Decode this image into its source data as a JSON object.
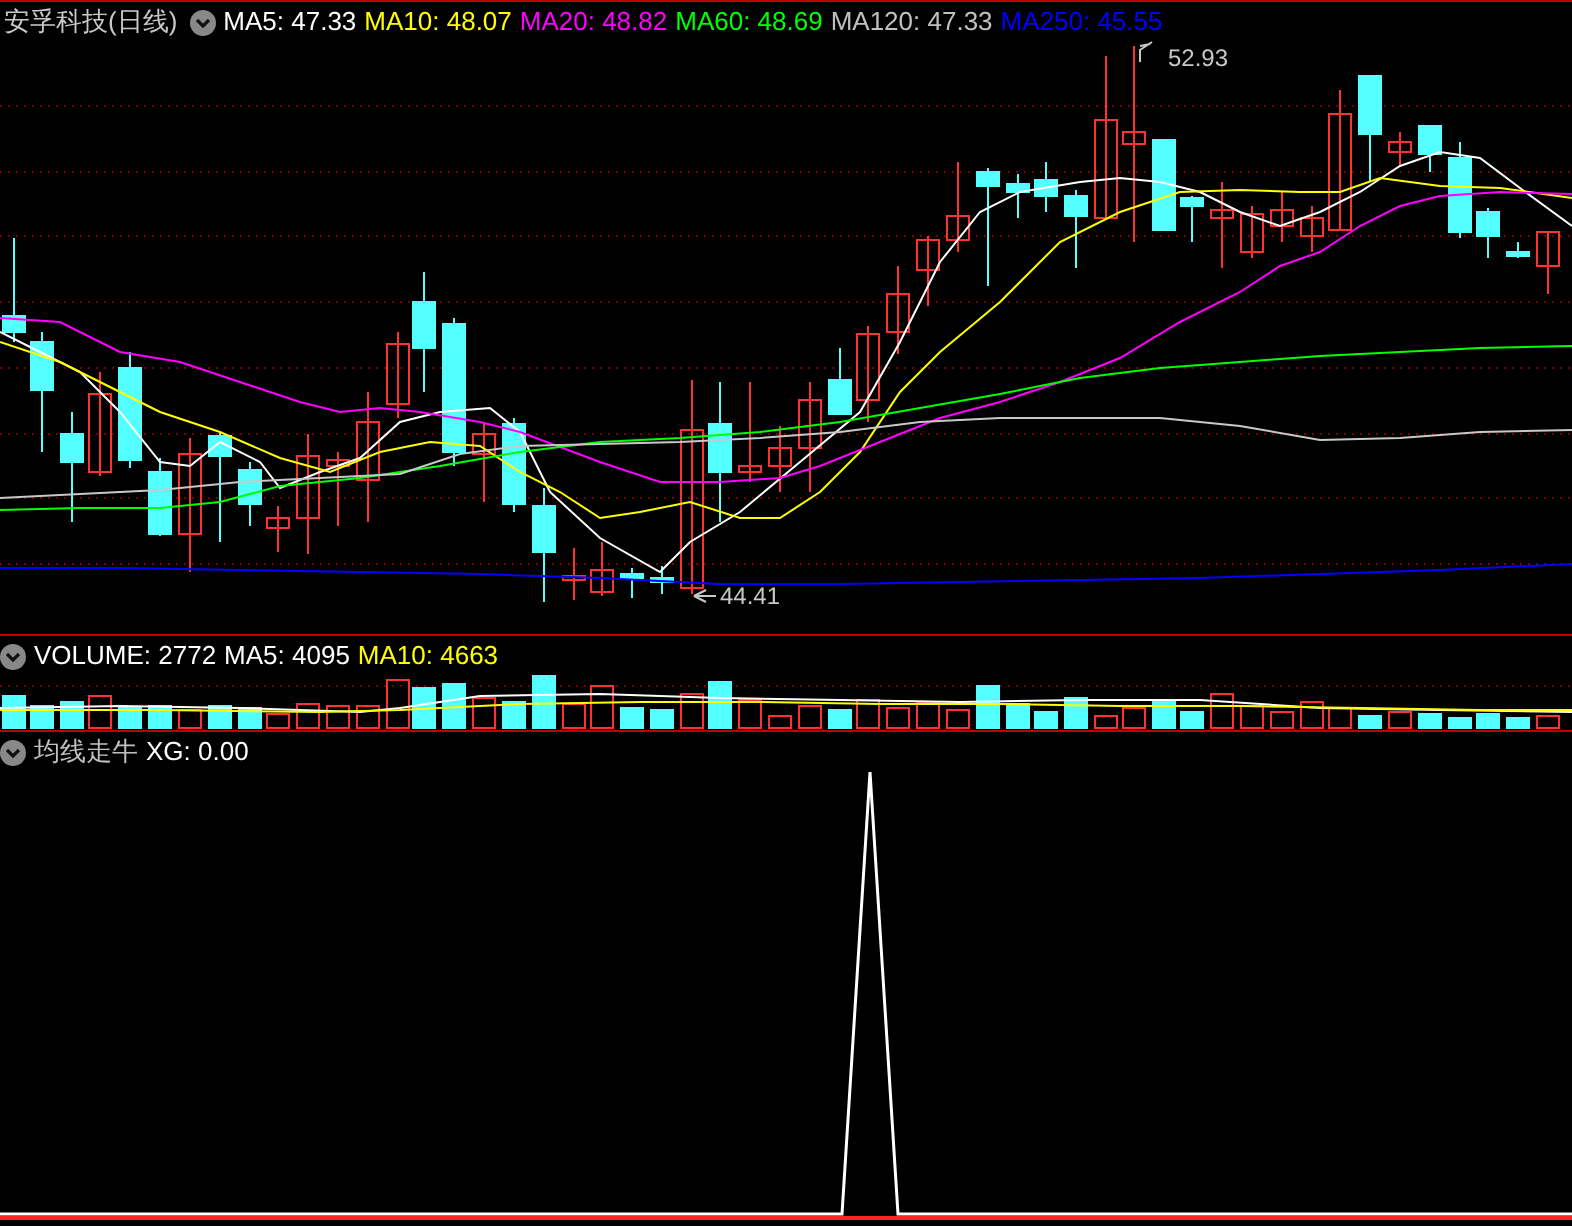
{
  "main_panel": {
    "title": "安孚科技(日线)",
    "legend": [
      {
        "text": "MA5: 47.33",
        "color": "#ffffff"
      },
      {
        "text": "MA10: 48.07",
        "color": "#ffff00"
      },
      {
        "text": "MA20: 48.82",
        "color": "#ff00ff"
      },
      {
        "text": "MA60: 48.69",
        "color": "#00ff00"
      },
      {
        "text": "MA120: 47.33",
        "color": "#c0c0c0"
      },
      {
        "text": "MA250: 45.55",
        "color": "#0000ff"
      }
    ],
    "high_label": "52.93",
    "low_label": "44.41"
  },
  "volume_panel": {
    "legend": [
      {
        "text": "VOLUME: 2772",
        "color": "#ffffff"
      },
      {
        "text": "MA5: 4095",
        "color": "#ffffff"
      },
      {
        "text": "MA10: 4663",
        "color": "#ffff00"
      }
    ]
  },
  "indicator_panel": {
    "legend": [
      {
        "text": "均线走牛",
        "color": "#c0c0c0"
      },
      {
        "text": "XG: 0.00",
        "color": "#ffffff"
      }
    ]
  }
}
